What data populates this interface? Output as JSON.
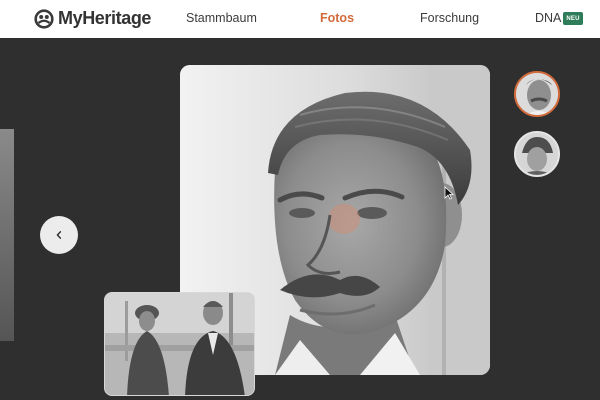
{
  "header": {
    "logo_text": "MyHeritage",
    "nav": {
      "stammbaum": "Stammbaum",
      "fotos": "Fotos",
      "forschung": "Forschung",
      "dna": "DNA"
    },
    "dna_badge": "NEU"
  },
  "viewer": {
    "prev_icon": "chevron-left-icon",
    "active_nav": "Fotos"
  },
  "colors": {
    "accent": "#d26b3c",
    "badge": "#2f7c5a",
    "background": "#2f2f2f",
    "header": "#ffffff"
  }
}
